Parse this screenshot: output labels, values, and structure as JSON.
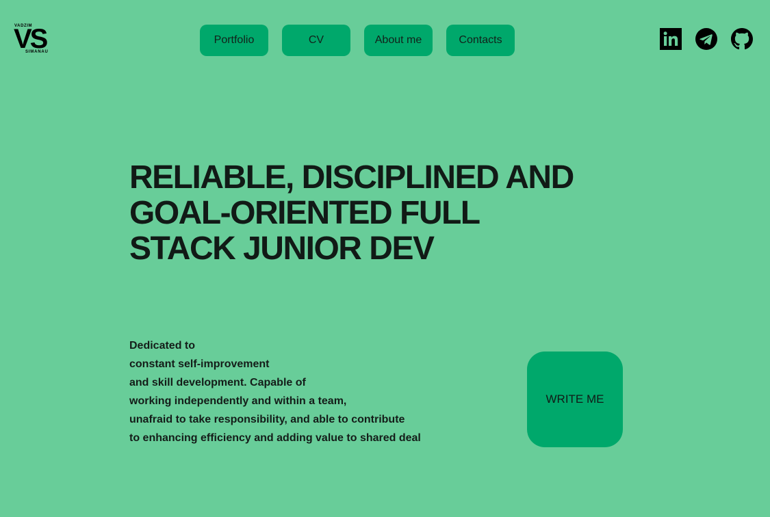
{
  "logo": {
    "top_name": "VADZIM",
    "monogram": "VS",
    "bottom_name": "SIMANAU"
  },
  "nav": {
    "items": [
      {
        "label": "Portfolio"
      },
      {
        "label": "CV"
      },
      {
        "label": "About me"
      },
      {
        "label": "Contacts"
      }
    ]
  },
  "socials": [
    {
      "icon": "linkedin-icon"
    },
    {
      "icon": "telegram-icon"
    },
    {
      "icon": "github-icon"
    }
  ],
  "hero": {
    "lines": [
      "RELIABLE, DISCIPLINED AND",
      "GOAL-ORIENTED FULL",
      "STACK JUNIOR DEV"
    ]
  },
  "description": {
    "lines": [
      "Dedicated to",
      "constant self-improvement",
      "and skill development. Capable of",
      "working independently and within a team,",
      "unafraid to take responsibility, and able to contribute",
      "to enhancing efficiency and adding value to shared deal"
    ]
  },
  "cta": {
    "label": "WRITE ME"
  },
  "colors": {
    "background": "#68cd99",
    "accent": "#00a86b",
    "text": "#111a16"
  }
}
